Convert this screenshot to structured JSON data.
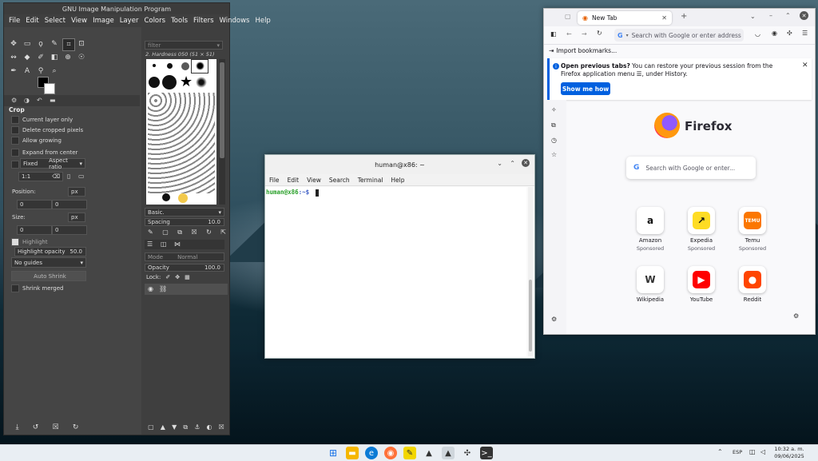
{
  "gimp": {
    "title": "GNU Image Manipulation Program",
    "menu": [
      "File",
      "Edit",
      "Select",
      "View",
      "Image",
      "Layer",
      "Colors",
      "Tools",
      "Filters",
      "Windows",
      "Help"
    ],
    "tool_options_title": "Crop",
    "options": {
      "current_layer_only": "Current layer only",
      "delete_cropped": "Delete cropped pixels",
      "allow_growing": "Allow growing",
      "expand_from_center": "Expand from center",
      "fixed": "Fixed",
      "aspect_ratio": "Aspect ratio",
      "ratio_value": "1:1",
      "position_label": "Position:",
      "position_unit": "px",
      "position_x": "0",
      "position_y": "0",
      "size_label": "Size:",
      "size_unit": "px",
      "size_x": "0",
      "size_y": "0",
      "highlight": "Highlight",
      "highlight_opacity_label": "Highlight opacity",
      "highlight_opacity_value": "50.0",
      "guides": "No guides",
      "auto_shrink": "Auto Shrink",
      "shrink_merged": "Shrink merged"
    },
    "brushes": {
      "filter": "filter",
      "current": "2. Hardness 050 (51 × 51)",
      "preset": "Basic.",
      "spacing_label": "Spacing",
      "spacing_value": "10.0"
    },
    "layers": {
      "mode_label": "Mode",
      "mode_value": "Normal",
      "opacity_label": "Opacity",
      "opacity_value": "100.0",
      "lock_label": "Lock:"
    }
  },
  "terminal": {
    "title": "human@x86: ~",
    "menu": [
      "File",
      "Edit",
      "View",
      "Search",
      "Terminal",
      "Help"
    ],
    "prompt_user": "human@x86",
    "prompt_path": ":~$"
  },
  "firefox": {
    "tab_title": "New Tab",
    "url_placeholder": "Search with Google or enter address",
    "import_bookmarks": "Import bookmarks...",
    "notice_bold": "Open previous tabs?",
    "notice_text": " You can restore your previous session from the Firefox application menu ☰, under History.",
    "show_me_how": "Show me how",
    "brand": "Firefox",
    "search_placeholder": "Search with Google or enter...",
    "tiles": [
      {
        "name": "Amazon",
        "sub": "Sponsored",
        "glyph": "a",
        "color": "#111",
        "bg": "#fff"
      },
      {
        "name": "Expedia",
        "sub": "Sponsored",
        "glyph": "↗",
        "color": "#111",
        "bg": "#fedc24"
      },
      {
        "name": "Temu",
        "sub": "Sponsored",
        "glyph": "TEMU",
        "color": "#fff",
        "bg": "#fb7701"
      },
      {
        "name": "Wikipedia",
        "sub": "",
        "glyph": "W",
        "color": "#333",
        "bg": "#fff"
      },
      {
        "name": "YouTube",
        "sub": "",
        "glyph": "▶",
        "color": "#fff",
        "bg": "#ff0000"
      },
      {
        "name": "Reddit",
        "sub": "",
        "glyph": "●",
        "color": "#fff",
        "bg": "#ff4500"
      }
    ]
  },
  "taskbar": {
    "language": "ESP",
    "time": "10:32 a. m.",
    "date": "09/06/2025"
  }
}
